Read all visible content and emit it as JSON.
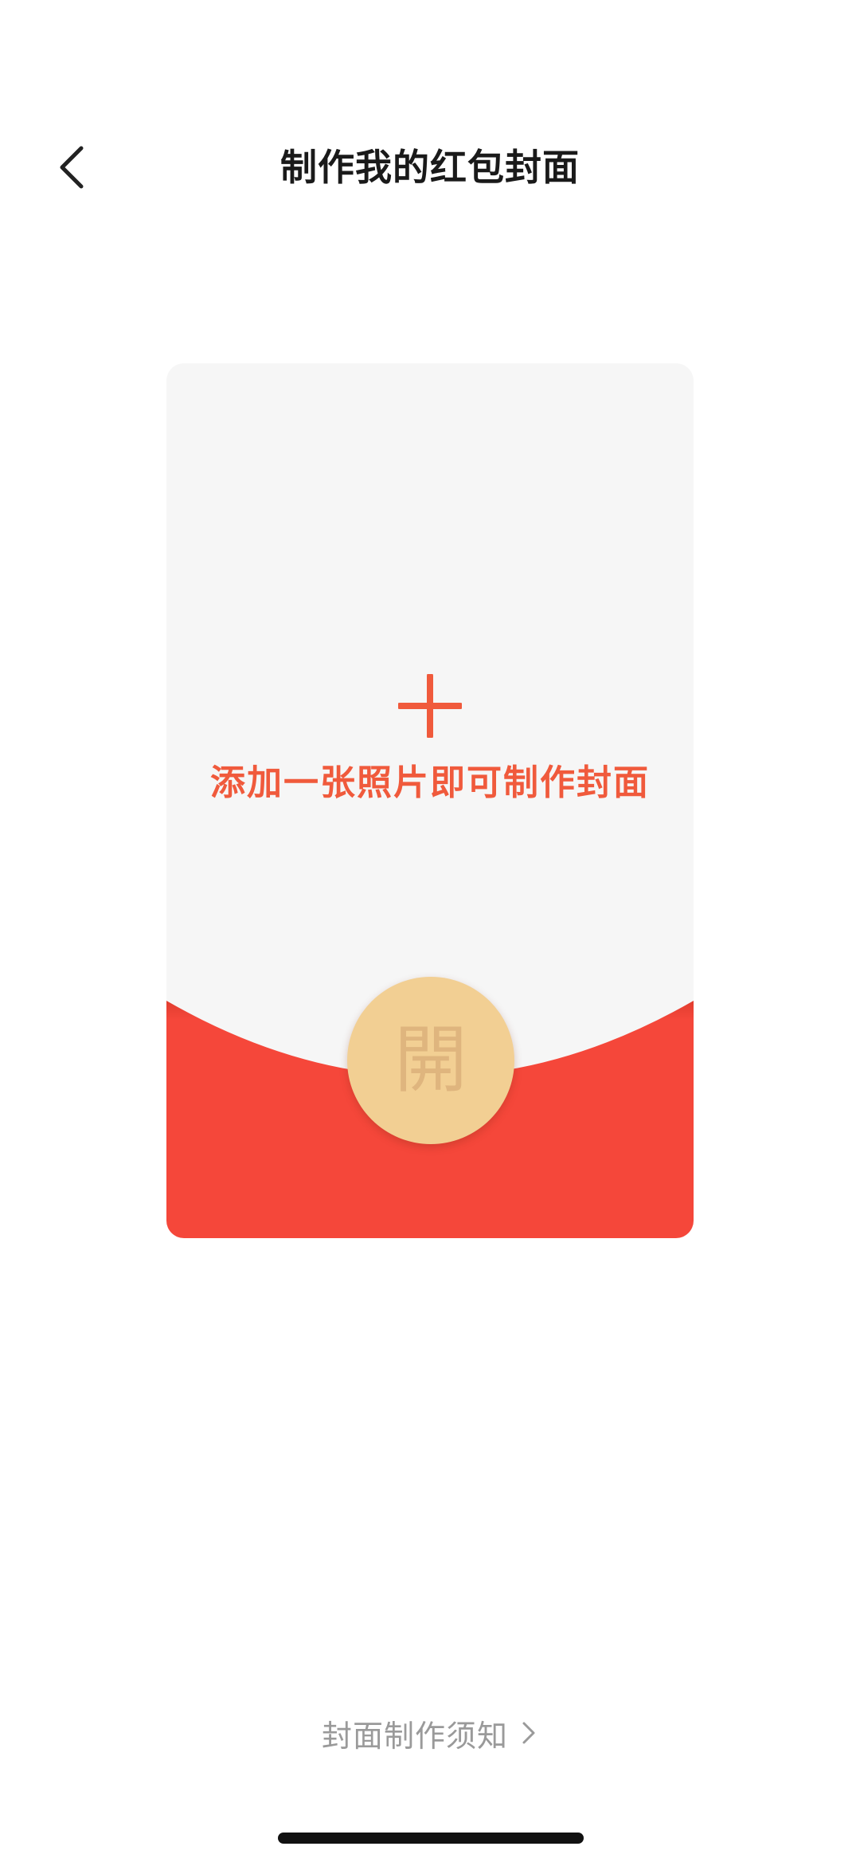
{
  "header": {
    "title": "制作我的红包封面",
    "back_icon": "chevron-left-icon"
  },
  "cover": {
    "add_icon": "plus-icon",
    "hint": "添加一张照片即可制作封面",
    "open_label": "開"
  },
  "footer": {
    "guide_label": "封面制作须知",
    "guide_icon": "chevron-right-icon"
  },
  "colors": {
    "accent_red": "#f5473a",
    "hint_red": "#f05a3c",
    "gold": "#f2cf93",
    "card_bg": "#f6f6f6"
  }
}
